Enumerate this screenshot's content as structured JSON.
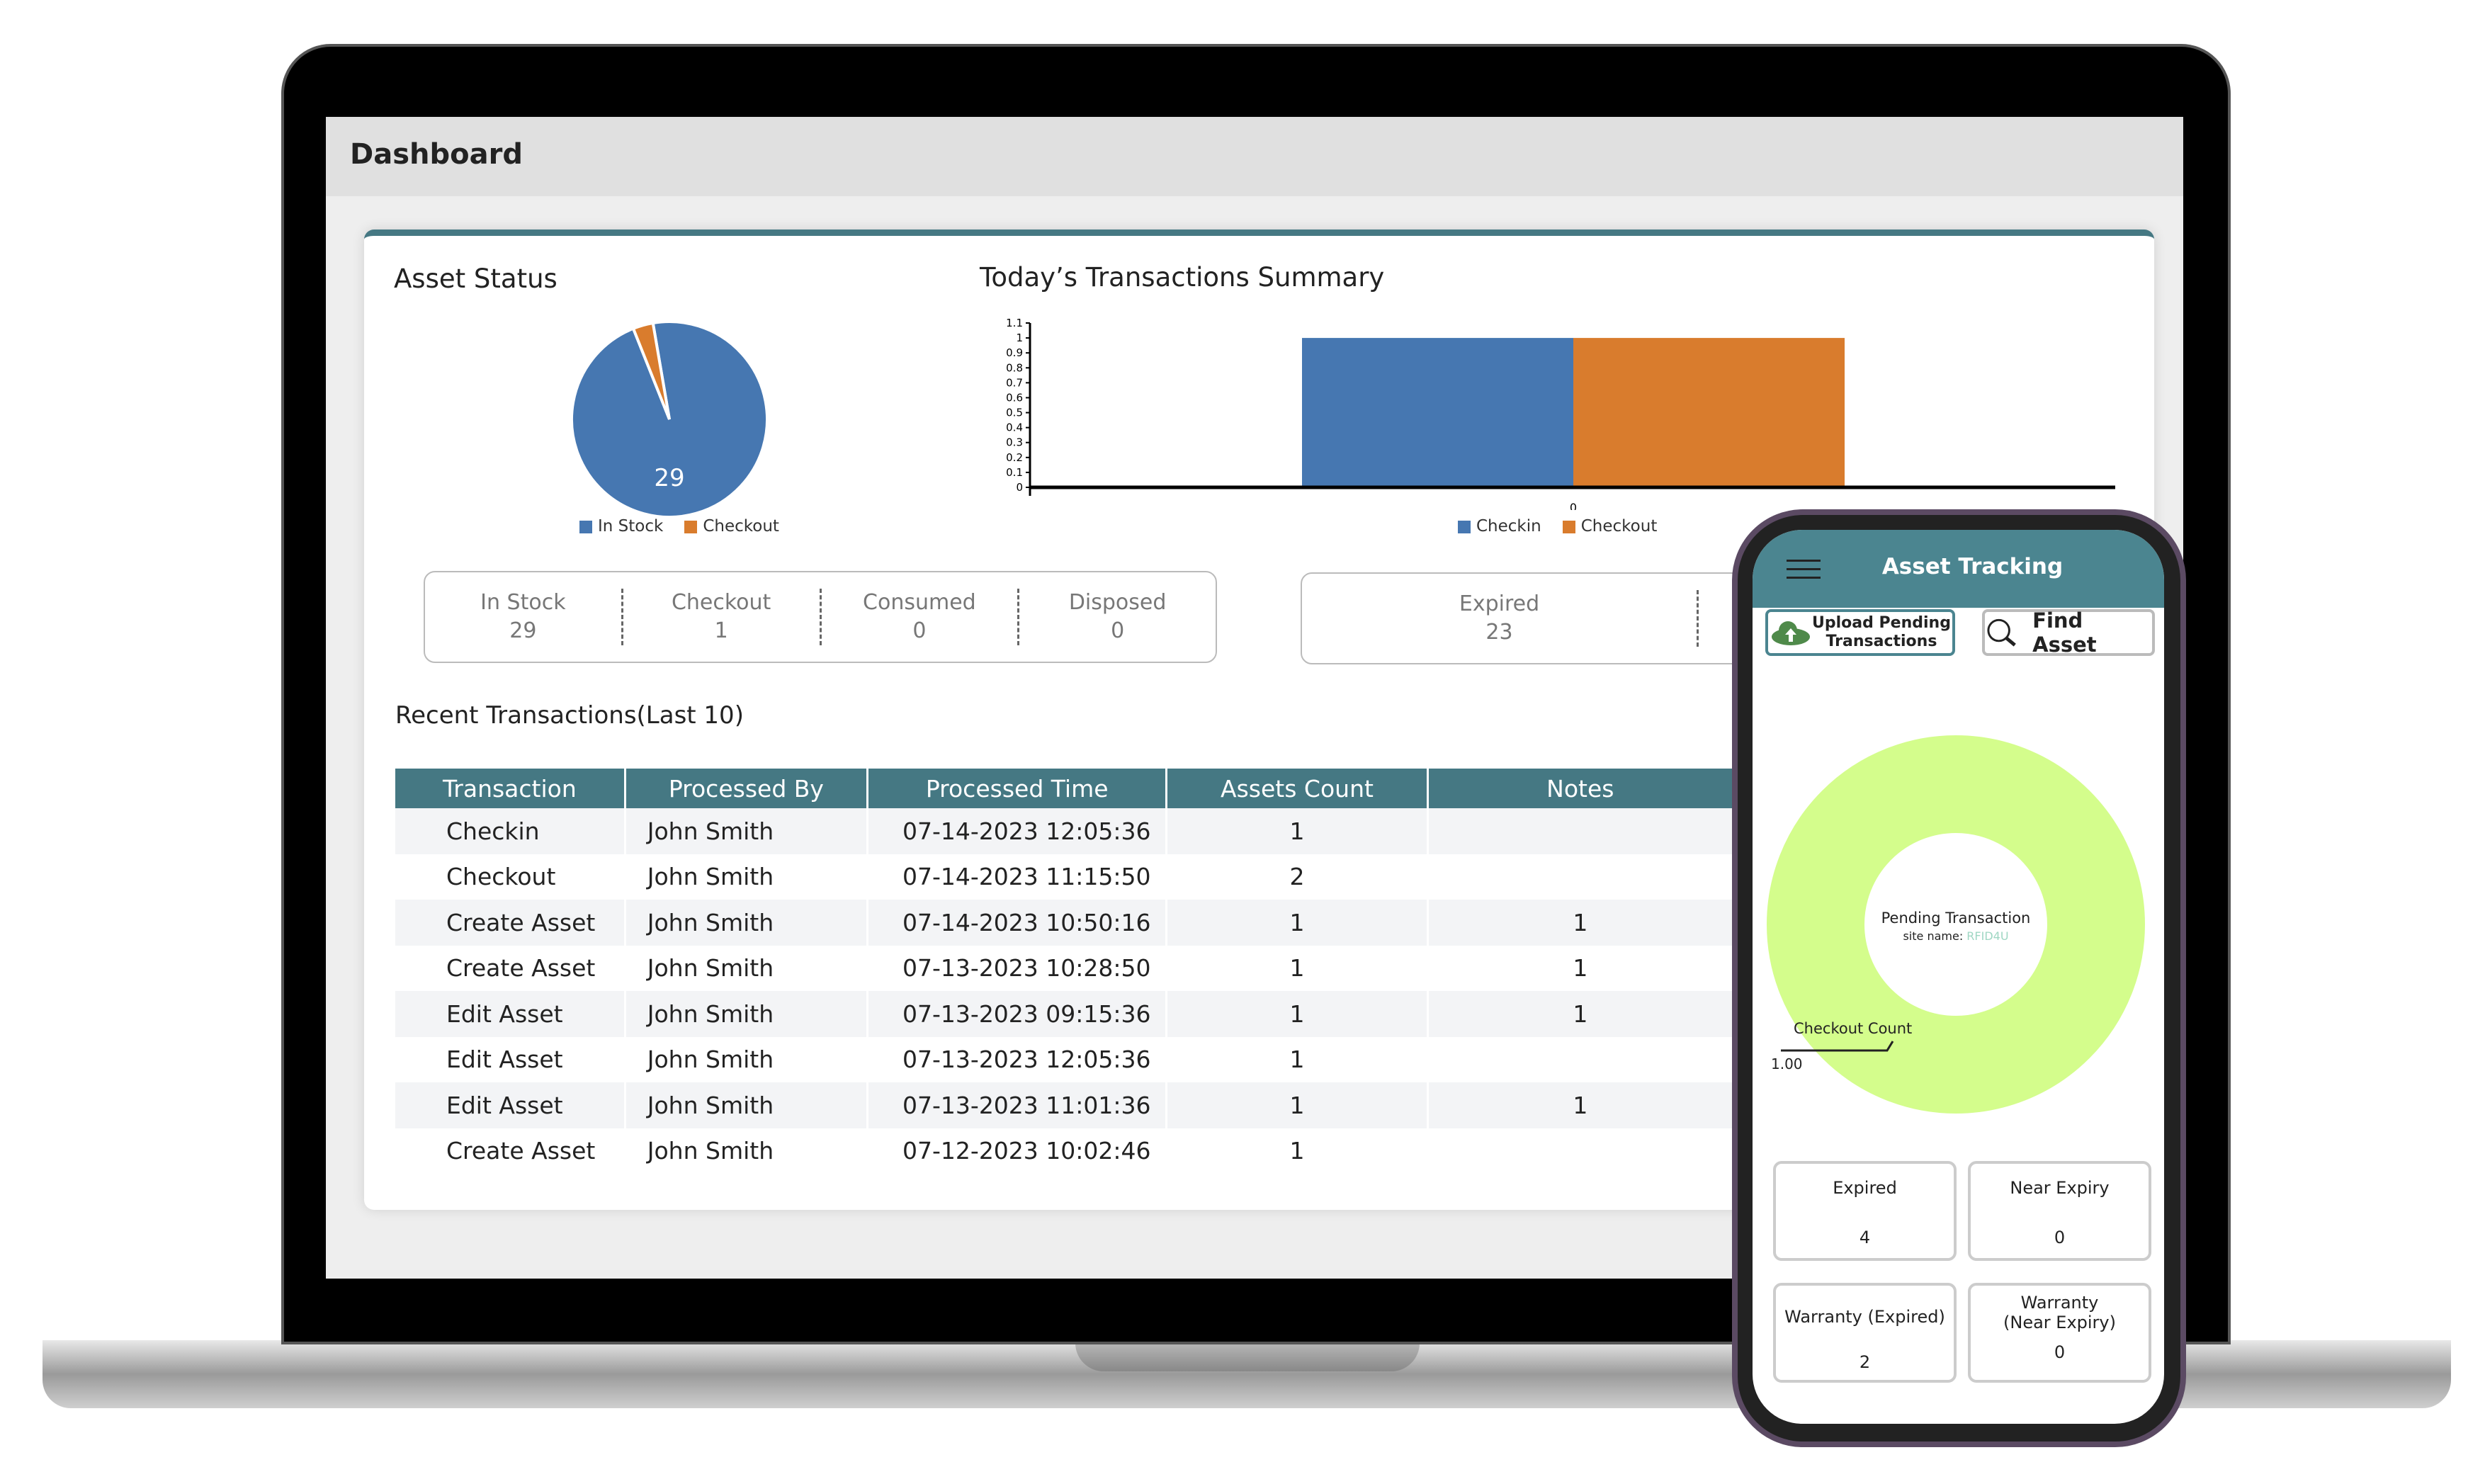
{
  "dashboard": {
    "title": "Dashboard",
    "asset_status": {
      "title": "Asset Status",
      "pie_label": "29",
      "legend": [
        "In Stock",
        "Checkout"
      ]
    },
    "transactions_summary": {
      "title": "Today’s Transactions Summary",
      "legend": [
        "Checkin",
        "Checkout"
      ]
    },
    "stats": [
      {
        "label": "In Stock",
        "value": "29"
      },
      {
        "label": "Checkout",
        "value": "1"
      },
      {
        "label": "Consumed",
        "value": "0"
      },
      {
        "label": "Disposed",
        "value": "0"
      }
    ],
    "expired": {
      "label": "Expired",
      "value": "23"
    },
    "recent": {
      "title": "Recent Transactions(Last 10)",
      "columns": [
        "Transaction",
        "Processed By",
        "Processed Time",
        "Assets Count",
        "Notes"
      ],
      "rows": [
        [
          "Checkin",
          "John Smith",
          "07-14-2023 12:05:36",
          "1",
          ""
        ],
        [
          "Checkout",
          "John Smith",
          "07-14-2023 11:15:50",
          "2",
          ""
        ],
        [
          "Create Asset",
          "John Smith",
          "07-14-2023 10:50:16",
          "1",
          "1"
        ],
        [
          "Create Asset",
          "John Smith",
          "07-13-2023 10:28:50",
          "1",
          "1"
        ],
        [
          "Edit Asset",
          "John Smith",
          "07-13-2023 09:15:36",
          "1",
          "1"
        ],
        [
          "Edit Asset",
          "John Smith",
          "07-13-2023 12:05:36",
          "1",
          ""
        ],
        [
          "Edit Asset",
          "John Smith",
          "07-13-2023 11:01:36",
          "1",
          "1"
        ],
        [
          "Create Asset",
          "John Smith",
          "07-12-2023 10:02:46",
          "1",
          ""
        ]
      ]
    }
  },
  "phone": {
    "title": "Asset Tracking",
    "upload_label_1": "Upload Pending",
    "upload_label_2": "Transactions",
    "find_label": "Find Asset",
    "donut_title": "Pending Transaction",
    "site_label": "site name: ",
    "site_name": "RFID4U",
    "callout_label": "Checkout Count",
    "callout_value": "1.00",
    "cards": [
      {
        "label": "Expired",
        "value": "4"
      },
      {
        "label": "Near Expiry",
        "value": "0"
      },
      {
        "label": "Warranty (Expired)",
        "value": "2"
      },
      {
        "label": "Warranty (Near Expiry)",
        "value": "0"
      }
    ]
  },
  "colors": {
    "blue": "#4677b1",
    "orange": "#d97c2d",
    "teal": "#457883",
    "donut": "#d4fd8c"
  },
  "chart_data": [
    {
      "type": "pie",
      "title": "Asset Status",
      "categories": [
        "In Stock",
        "Checkout"
      ],
      "values": [
        29,
        1
      ],
      "legend": "bottom"
    },
    {
      "type": "bar",
      "title": "Today’s Transactions Summary",
      "categories": [
        "0"
      ],
      "series": [
        {
          "name": "Checkin",
          "values": [
            1
          ]
        },
        {
          "name": "Checkout",
          "values": [
            1
          ]
        }
      ],
      "ylim": [
        0,
        1.1
      ],
      "yticks": [
        0,
        0.1,
        0.2,
        0.3,
        0.4,
        0.5,
        0.6,
        0.7,
        0.8,
        0.9,
        1,
        1.1
      ],
      "legend": "bottom"
    },
    {
      "type": "pie",
      "title": "Pending Transaction",
      "categories": [
        "Checkout Count"
      ],
      "values": [
        1.0
      ]
    }
  ]
}
